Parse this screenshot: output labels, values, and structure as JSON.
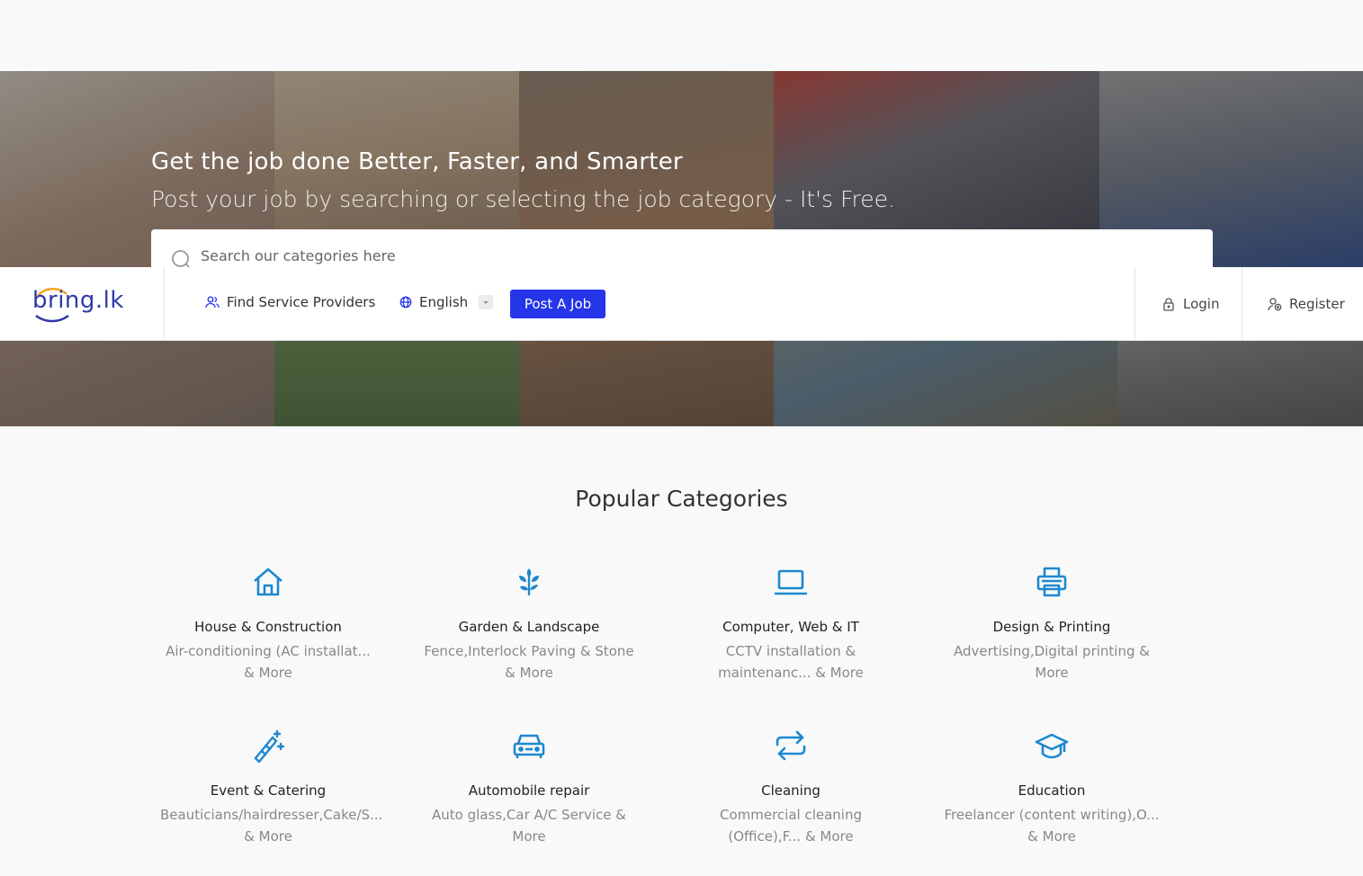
{
  "hero": {
    "title": "Get the job done Better, Faster, and Smarter",
    "subtitle": "Post your job by searching or selecting the job category - It's Free.",
    "search_placeholder": "Search our categories here"
  },
  "navbar": {
    "logo_text": "bring.lk",
    "find_label": "Find Service Providers",
    "language_label": "English",
    "post_job_label": "Post A Job",
    "login_label": "Login",
    "register_label": "Register"
  },
  "categories": {
    "title": "Popular Categories",
    "items": [
      {
        "name": "House & Construction",
        "sub": "Air-conditioning (AC installat... & More",
        "icon": "house-icon"
      },
      {
        "name": "Garden & Landscape",
        "sub": "Fence,Interlock Paving & Stone & More",
        "icon": "plant-icon"
      },
      {
        "name": "Computer, Web & IT",
        "sub": "CCTV installation & maintenanc... & More",
        "icon": "laptop-icon"
      },
      {
        "name": "Design & Printing",
        "sub": "Advertising,Digital printing & More",
        "icon": "printer-icon"
      },
      {
        "name": "Event & Catering",
        "sub": "Beauticians/hairdresser,Cake/S... & More",
        "icon": "magic-wand-icon"
      },
      {
        "name": "Automobile repair",
        "sub": "Auto glass,Car A/C Service & More",
        "icon": "car-icon"
      },
      {
        "name": "Cleaning",
        "sub": "Commercial cleaning (Office),F... & More",
        "icon": "repeat-icon"
      },
      {
        "name": "Education",
        "sub": "Freelancer (content writing),O... & More",
        "icon": "graduation-cap-icon"
      }
    ]
  },
  "colors": {
    "accent": "#2535e8",
    "icon": "#1e88d0",
    "logo": "#2f3aa8"
  }
}
